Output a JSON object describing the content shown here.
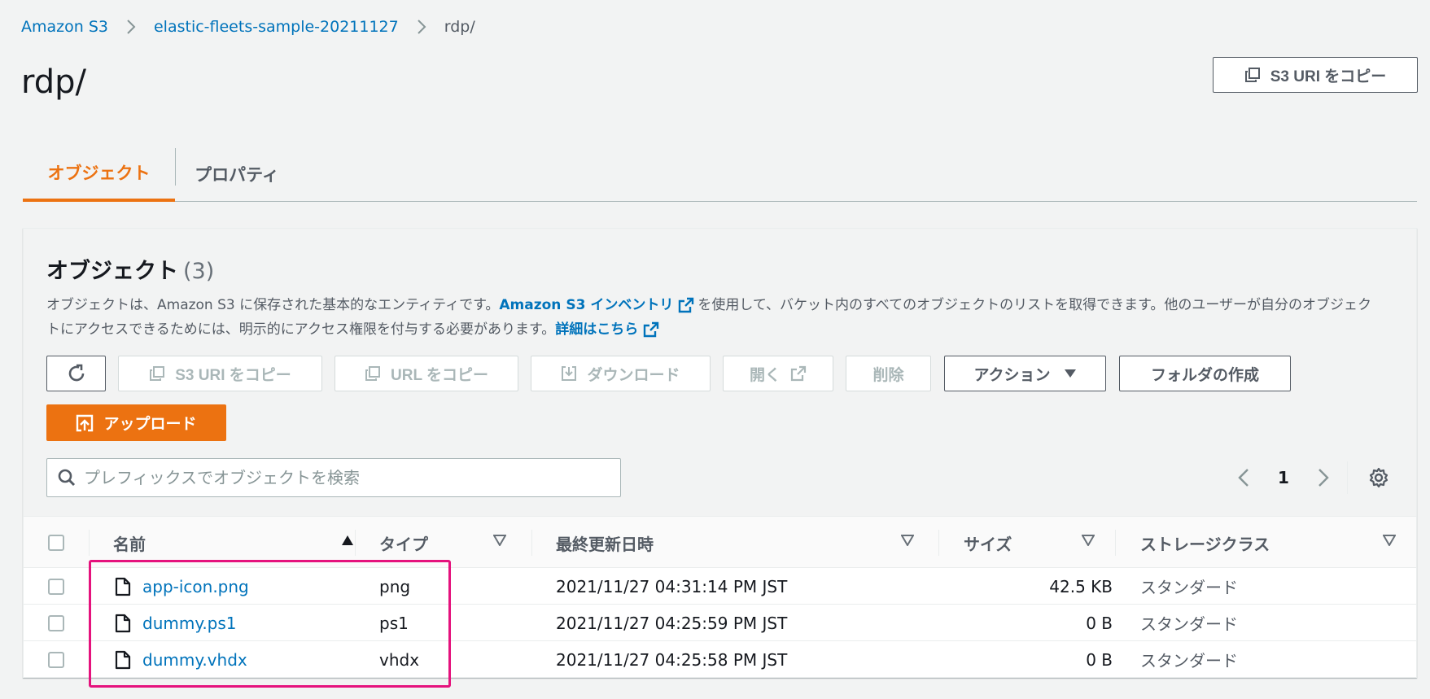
{
  "breadcrumb": {
    "items": [
      "Amazon S3",
      "elastic-fleets-sample-20211127"
    ],
    "current": "rdp/"
  },
  "page": {
    "title": "rdp/",
    "copy_uri_label": "S3 URI をコピー"
  },
  "tabs": [
    {
      "label": "オブジェクト",
      "active": true
    },
    {
      "label": "プロパティ",
      "active": false
    }
  ],
  "objects": {
    "heading": "オブジェクト",
    "count": "(3)",
    "desc_part1": "オブジェクトは、Amazon S3 に保存された基本的なエンティティです。",
    "inventory_link": "Amazon S3 インベントリ",
    "desc_part2": "を使用して、バケット内のすべてのオブジェクトのリストを取得できます。他のユーザーが自分のオブジェクトにアクセスできるためには、明示的にアクセス権限を付与する必要があります。",
    "details_link": "詳細はこちら"
  },
  "toolbar": {
    "copy_s3_uri": "S3 URI をコピー",
    "copy_url": "URL をコピー",
    "download": "ダウンロード",
    "open": "開く",
    "delete": "削除",
    "actions": "アクション",
    "create_folder": "フォルダの作成",
    "upload": "アップロード"
  },
  "search": {
    "placeholder": "プレフィックスでオブジェクトを検索",
    "value": ""
  },
  "pagination": {
    "current_page": "1"
  },
  "table": {
    "columns": {
      "name": "名前",
      "type": "タイプ",
      "last_modified": "最終更新日時",
      "size": "サイズ",
      "storage_class": "ストレージクラス"
    },
    "rows": [
      {
        "name": "app-icon.png",
        "type": "png",
        "last_modified": "2021/11/27 04:31:14 PM JST",
        "size": "42.5 KB",
        "storage_class": "スタンダード"
      },
      {
        "name": "dummy.ps1",
        "type": "ps1",
        "last_modified": "2021/11/27 04:25:59 PM JST",
        "size": "0 B",
        "storage_class": "スタンダード"
      },
      {
        "name": "dummy.vhdx",
        "type": "vhdx",
        "last_modified": "2021/11/27 04:25:58 PM JST",
        "size": "0 B",
        "storage_class": "スタンダード"
      }
    ]
  },
  "colors": {
    "accent": "#ec7211",
    "link": "#0073bb",
    "highlight": "#e5127d"
  },
  "icons": {
    "copy": "copy-icon",
    "refresh": "refresh-icon",
    "download": "download-icon",
    "external": "external-link-icon",
    "upload": "upload-icon",
    "search": "search-icon",
    "settings": "gear-icon",
    "file": "file-icon"
  }
}
